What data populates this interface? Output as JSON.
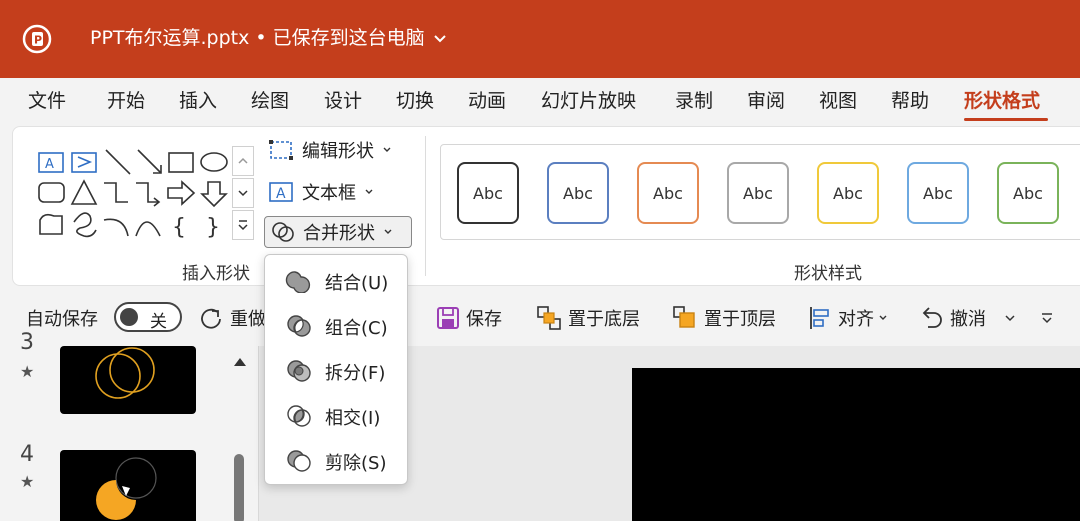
{
  "window": {
    "title": "PPT布尔运算.pptx • 已保存到这台电脑",
    "accent": "#c43e1c"
  },
  "menu": {
    "items": [
      "文件",
      "开始",
      "插入",
      "绘图",
      "设计",
      "切换",
      "动画",
      "幻灯片放映",
      "录制",
      "审阅",
      "视图",
      "帮助",
      "形状格式"
    ],
    "active": "形状格式"
  },
  "ribbon": {
    "insert_shapes": {
      "edit_shape_label": "编辑形状",
      "text_box_label": "文本框",
      "merge_shapes_label": "合并形状",
      "group_label": "插入形状"
    },
    "shape_styles": {
      "group_label": "形状样式",
      "swatch_text": "Abc",
      "swatches": [
        {
          "border": "#333333"
        },
        {
          "border": "#5b7fc0"
        },
        {
          "border": "#e58a52"
        },
        {
          "border": "#a8a8a8"
        },
        {
          "border": "#f0c93a"
        },
        {
          "border": "#6ea9e0"
        },
        {
          "border": "#7ab35a"
        }
      ]
    }
  },
  "merge_menu": {
    "items": [
      {
        "label": "结合(U)",
        "icon": "union-icon"
      },
      {
        "label": "组合(C)",
        "icon": "combine-icon"
      },
      {
        "label": "拆分(F)",
        "icon": "fragment-icon"
      },
      {
        "label": "相交(I)",
        "icon": "intersect-icon"
      },
      {
        "label": "剪除(S)",
        "icon": "subtract-icon"
      }
    ]
  },
  "quick_access": {
    "autosave_label": "自动保存",
    "autosave_state": "关",
    "redo_label": "重做",
    "save_label": "保存",
    "send_back_label": "置于底层",
    "bring_front_label": "置于顶层",
    "align_label": "对齐",
    "undo_label": "撤消"
  },
  "slides": [
    {
      "number": "3",
      "star": "★"
    },
    {
      "number": "4",
      "star": "★"
    }
  ]
}
